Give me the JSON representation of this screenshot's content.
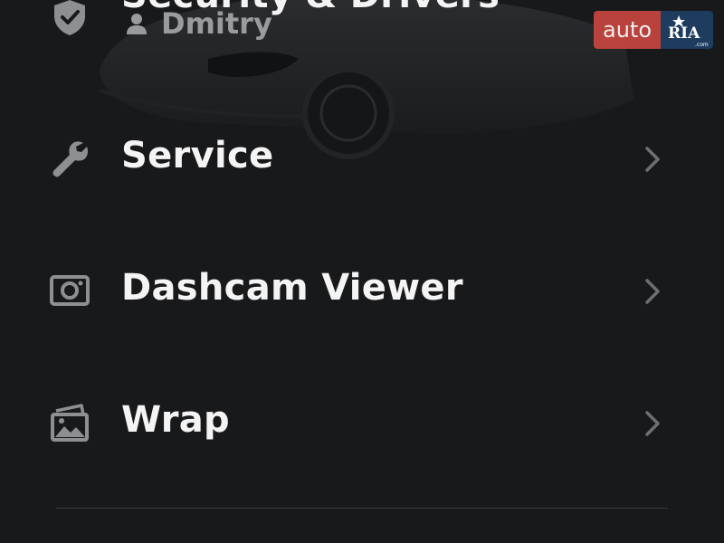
{
  "menu": {
    "security": {
      "label": "Security & Drivers",
      "driver_name": "Dmitry",
      "icon": "shield-check-icon"
    },
    "service": {
      "label": "Service",
      "icon": "wrench-icon"
    },
    "dashcam": {
      "label": "Dashcam Viewer",
      "icon": "camera-icon"
    },
    "wrap": {
      "label": "Wrap",
      "icon": "images-icon"
    }
  },
  "watermark": {
    "left_text": "auto",
    "right_text": "RIA",
    "right_small": ".com"
  },
  "colors": {
    "background": "#18191b",
    "text_primary": "#f4f4f4",
    "text_secondary": "#9a9b9d",
    "icon": "#8e8f91",
    "watermark_red": "#c8463f",
    "watermark_blue": "#1d3c5e"
  }
}
